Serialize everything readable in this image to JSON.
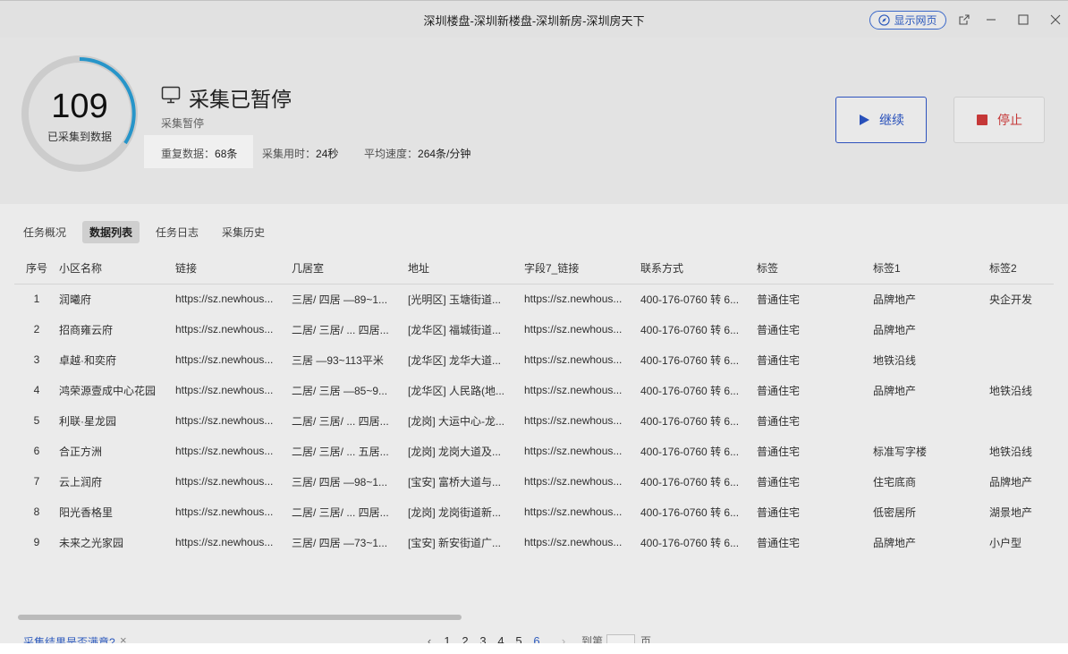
{
  "window": {
    "title": "深圳楼盘-深圳新楼盘-深圳新房-深圳房天下",
    "show_web_label": "显示网页"
  },
  "progress": {
    "count": "109",
    "count_label": "已采集到数据",
    "status_title": "采集已暂停",
    "status_sub": "采集暂停",
    "duplicate_label": "重复数据：",
    "duplicate_value": "68条",
    "time_label": "采集用时：",
    "time_value": "24秒",
    "speed_label": "平均速度：",
    "speed_value": "264条/分钟"
  },
  "actions": {
    "continue_label": "继续",
    "stop_label": "停止"
  },
  "tabs": [
    {
      "label": "任务概况"
    },
    {
      "label": "数据列表"
    },
    {
      "label": "任务日志"
    },
    {
      "label": "采集历史"
    }
  ],
  "table": {
    "columns": [
      "序号",
      "小区名称",
      "链接",
      "几居室",
      "地址",
      "字段7_链接",
      "联系方式",
      "标签",
      "标签1",
      "标签2"
    ],
    "rows": [
      [
        "1",
        "润曦府",
        "https://sz.newhous...",
        "三居/ 四居 —89~1...",
        "[光明区] 玉塘街道...",
        "https://sz.newhous...",
        "400-176-0760 转 6...",
        "普通住宅",
        "品牌地产",
        "央企开发"
      ],
      [
        "2",
        "招商雍云府",
        "https://sz.newhous...",
        "二居/ 三居/ ... 四居...",
        "[龙华区] 福城街道...",
        "https://sz.newhous...",
        "400-176-0760 转 6...",
        "普通住宅",
        "品牌地产",
        ""
      ],
      [
        "3",
        "卓越·和奕府",
        "https://sz.newhous...",
        "三居 —93~113平米",
        "[龙华区] 龙华大道...",
        "https://sz.newhous...",
        "400-176-0760 转 6...",
        "普通住宅",
        "地铁沿线",
        ""
      ],
      [
        "4",
        "鸿荣源壹成中心花园",
        "https://sz.newhous...",
        "二居/ 三居 —85~9...",
        "[龙华区] 人民路(地...",
        "https://sz.newhous...",
        "400-176-0760 转 6...",
        "普通住宅",
        "品牌地产",
        "地铁沿线"
      ],
      [
        "5",
        "利联·星龙园",
        "https://sz.newhous...",
        "二居/ 三居/ ... 四居...",
        "[龙岗] 大运中心-龙...",
        "https://sz.newhous...",
        "400-176-0760 转 6...",
        "普通住宅",
        "",
        ""
      ],
      [
        "6",
        "合正方洲",
        "https://sz.newhous...",
        "二居/ 三居/ ... 五居...",
        "[龙岗] 龙岗大道及...",
        "https://sz.newhous...",
        "400-176-0760 转 6...",
        "普通住宅",
        "标准写字楼",
        "地铁沿线"
      ],
      [
        "7",
        "云上润府",
        "https://sz.newhous...",
        "三居/ 四居 —98~1...",
        "[宝安] 富桥大道与...",
        "https://sz.newhous...",
        "400-176-0760 转 6...",
        "普通住宅",
        "住宅底商",
        "品牌地产"
      ],
      [
        "8",
        "阳光香格里",
        "https://sz.newhous...",
        "二居/ 三居/ ... 四居...",
        "[龙岗] 龙岗街道新...",
        "https://sz.newhous...",
        "400-176-0760 转 6...",
        "普通住宅",
        "低密居所",
        "湖景地产"
      ],
      [
        "9",
        "未来之光家园",
        "https://sz.newhous...",
        "三居/ 四居 —73~1...",
        "[宝安] 新安街道广...",
        "https://sz.newhous...",
        "400-176-0760 转 6...",
        "普通住宅",
        "品牌地产",
        "小户型"
      ]
    ]
  },
  "footer": {
    "feedback_label": "采集结果是否满意?",
    "feedback_close": "×",
    "pages": [
      "1",
      "2",
      "3",
      "4",
      "5",
      "6"
    ],
    "current_page": "6",
    "goto_label": "到第",
    "page_suffix": "页"
  },
  "colors": {
    "accent": "#2f5fc8",
    "stop": "#d23b3b",
    "ring": "#2a9fd6"
  }
}
